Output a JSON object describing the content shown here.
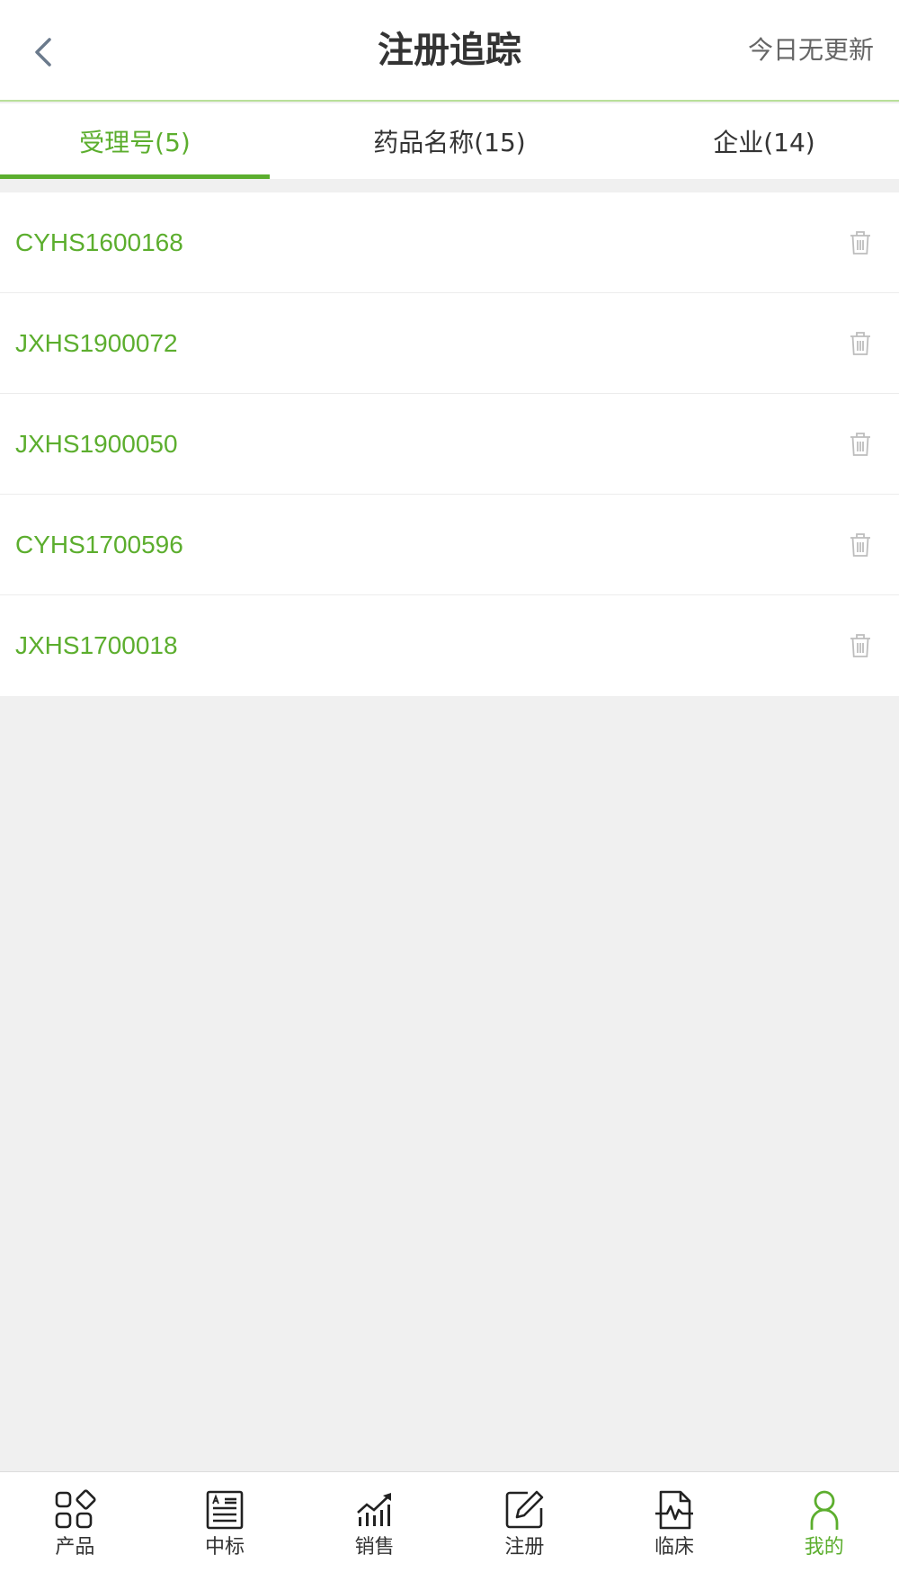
{
  "header": {
    "title": "注册追踪",
    "right_text": "今日无更新"
  },
  "tabs": [
    {
      "label": "受理号(5)",
      "active": true
    },
    {
      "label": "药品名称(15)",
      "active": false
    },
    {
      "label": "企业(14)",
      "active": false
    }
  ],
  "items": [
    {
      "code": "CYHS1600168"
    },
    {
      "code": "JXHS1900072"
    },
    {
      "code": "JXHS1900050"
    },
    {
      "code": "CYHS1700596"
    },
    {
      "code": "JXHS1700018"
    }
  ],
  "tabbar": [
    {
      "label": "产品",
      "icon": "product-icon",
      "active": false
    },
    {
      "label": "中标",
      "icon": "bid-icon",
      "active": false
    },
    {
      "label": "销售",
      "icon": "sales-chart-icon",
      "active": false
    },
    {
      "label": "注册",
      "icon": "edit-icon",
      "active": false
    },
    {
      "label": "临床",
      "icon": "clinical-icon",
      "active": false
    },
    {
      "label": "我的",
      "icon": "user-icon",
      "active": true
    }
  ],
  "colors": {
    "accent": "#5cae2e",
    "background": "#f0f0f0",
    "text": "#333333"
  }
}
